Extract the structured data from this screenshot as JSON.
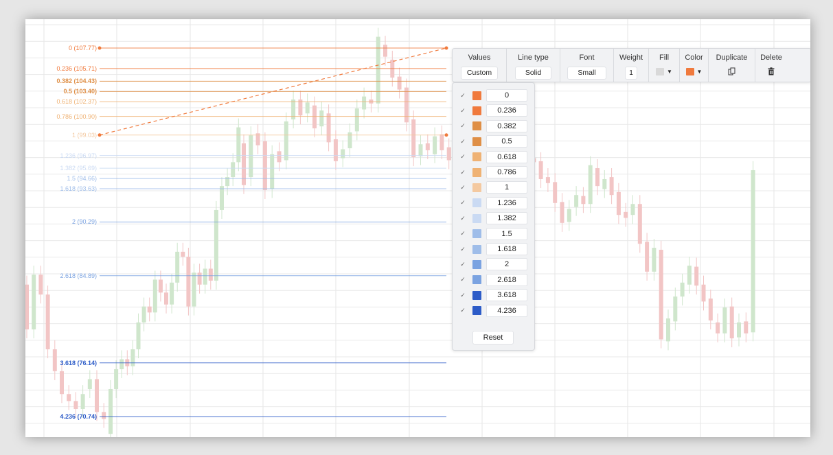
{
  "fib_levels": [
    {
      "ratio": "0",
      "label": "0 (107.77)",
      "price": 107.77,
      "color": "#f07a3d"
    },
    {
      "ratio": "0.236",
      "label": "0.236 (105.71)",
      "price": 105.71,
      "color": "#f07a3d"
    },
    {
      "ratio": "0.382",
      "label": "0.382 (104.43)",
      "price": 104.43,
      "color": "#df8f46"
    },
    {
      "ratio": "0.5",
      "label": "0.5 (103.40)",
      "price": 103.4,
      "color": "#df8f46"
    },
    {
      "ratio": "0.618",
      "label": "0.618 (102.37)",
      "price": 102.37,
      "color": "#efb274"
    },
    {
      "ratio": "0.786",
      "label": "0.786 (100.90)",
      "price": 100.9,
      "color": "#efb274"
    },
    {
      "ratio": "1",
      "label": "1 (99.03)",
      "price": 99.03,
      "color": "#f4c9a0"
    },
    {
      "ratio": "1.236",
      "label": "1.236 (96.97)",
      "price": 96.97,
      "color": "#cadaf3"
    },
    {
      "ratio": "1.382",
      "label": "1.382 (95.69)",
      "price": 95.69,
      "color": "#cadaf3"
    },
    {
      "ratio": "1.5",
      "label": "1.5 (94.66)",
      "price": 94.66,
      "color": "#9fbde9"
    },
    {
      "ratio": "1.618",
      "label": "1.618 (93.63)",
      "price": 93.63,
      "color": "#9fbde9"
    },
    {
      "ratio": "2",
      "label": "2 (90.29)",
      "price": 90.29,
      "color": "#7ba3e1"
    },
    {
      "ratio": "2.618",
      "label": "2.618 (84.89)",
      "price": 84.89,
      "color": "#7ba3e1"
    },
    {
      "ratio": "3.618",
      "label": "3.618 (76.14)",
      "price": 76.14,
      "color": "#2d5cc8"
    },
    {
      "ratio": "4.236",
      "label": "4.236 (70.74)",
      "price": 70.74,
      "color": "#2d5cc8"
    }
  ],
  "price_axis": {
    "top_price": 107.77,
    "bottom_price": 70.74
  },
  "toolbar": {
    "values_title": "Values",
    "values_value": "Custom",
    "linetype_title": "Line type",
    "linetype_value": "Solid",
    "font_title": "Font",
    "font_value": "Small",
    "weight_title": "Weight",
    "weight_value": "1",
    "fill_title": "Fill",
    "fill_color": "#d9d9d9",
    "color_title": "Color",
    "color_value": "#f07a3d",
    "duplicate_title": "Duplicate",
    "delete_title": "Delete"
  },
  "panel": {
    "reset_label": "Reset"
  },
  "candles": [
    [
      98.2,
      94.0
    ],
    [
      94.8,
      99.0
    ],
    [
      99.2,
      98.0
    ],
    [
      98.4,
      93.5
    ],
    [
      93.6,
      97.1
    ],
    [
      97.4,
      96.3
    ],
    [
      96.5,
      100.4
    ],
    [
      100.6,
      102.6
    ],
    [
      102.6,
      101.0
    ],
    [
      101.2,
      102.3
    ],
    [
      102.0,
      99.7
    ],
    [
      99.9,
      101.5
    ],
    [
      101.2,
      98.3
    ],
    [
      98.6,
      96.4
    ],
    [
      96.7,
      97.6
    ],
    [
      97.7,
      99.3
    ],
    [
      99.4,
      101.7
    ],
    [
      101.6,
      102.9
    ],
    [
      102.6,
      102.2
    ],
    [
      102.2,
      108.9
    ],
    [
      108.1,
      106.9
    ],
    [
      106.6,
      104.8
    ],
    [
      104.9,
      103.6
    ],
    [
      103.8,
      100.3
    ],
    [
      100.6,
      96.8
    ],
    [
      96.9,
      98.1
    ],
    [
      98.2,
      97.5
    ],
    [
      97.1,
      98.9
    ],
    [
      99.1,
      97.5
    ],
    [
      97.8,
      96.5
    ],
    [
      96.5,
      94.4
    ],
    [
      94.6,
      98.3
    ],
    [
      98.2,
      99.3
    ],
    [
      99.4,
      98.5
    ],
    [
      98.8,
      97.8
    ],
    [
      98.0,
      100.3
    ],
    [
      100.1,
      98.3
    ],
    [
      98.2,
      96.9
    ],
    [
      96.6,
      95.3
    ],
    [
      95.4,
      97.7
    ],
    [
      97.7,
      96.8
    ],
    [
      96.7,
      96.3
    ],
    [
      96.4,
      94.6
    ],
    [
      94.8,
      94.2
    ],
    [
      94.3,
      92.2
    ],
    [
      92.3,
      90.2
    ],
    [
      90.3,
      91.6
    ],
    [
      91.8,
      93.0
    ],
    [
      92.9,
      92.1
    ],
    [
      92.1,
      96.0
    ],
    [
      95.7,
      93.9
    ],
    [
      93.6,
      94.6
    ],
    [
      94.8,
      93.0
    ],
    [
      93.3,
      91.0
    ],
    [
      91.3,
      90.7
    ],
    [
      91.0,
      92.1
    ],
    [
      92.1,
      88.1
    ],
    [
      88.3,
      85.3
    ],
    [
      85.3,
      87.7
    ],
    [
      87.5,
      78.5
    ],
    [
      78.3,
      80.6
    ],
    [
      80.3,
      82.8
    ],
    [
      82.8,
      84.2
    ],
    [
      84.0,
      85.9
    ],
    [
      85.8,
      83.9
    ],
    [
      84.0,
      82.3
    ],
    [
      82.6,
      80.4
    ],
    [
      80.2,
      79.1
    ],
    [
      79.1,
      81.7
    ],
    [
      81.8,
      78.6
    ],
    [
      78.7,
      80.2
    ],
    [
      80.3,
      79.1
    ],
    [
      79.2,
      95.5
    ]
  ],
  "left_candles": [
    [
      84.0,
      79.5
    ],
    [
      79.5,
      85.0
    ],
    [
      85.0,
      83.0
    ],
    [
      83.0,
      77.5
    ],
    [
      77.5,
      75.3
    ],
    [
      75.3,
      73.0
    ],
    [
      73.0,
      72.3
    ],
    [
      72.3,
      71.5
    ],
    [
      71.5,
      73.0
    ],
    [
      73.5,
      74.5
    ],
    [
      74.5,
      71.2
    ],
    [
      71.2,
      70.5
    ]
  ],
  "rising_candles": [
    [
      69.0,
      73.5
    ],
    [
      73.5,
      75.5
    ],
    [
      75.5,
      76.5
    ],
    [
      76.5,
      75.8
    ],
    [
      75.8,
      77.5
    ],
    [
      77.5,
      80.2
    ],
    [
      80.2,
      81.8
    ],
    [
      81.8,
      81.2
    ],
    [
      81.2,
      84.5
    ],
    [
      84.5,
      83.2
    ],
    [
      83.2,
      82.0
    ],
    [
      82.0,
      84.2
    ],
    [
      84.2,
      87.3
    ],
    [
      87.3,
      86.8
    ],
    [
      86.8,
      81.8
    ],
    [
      81.8,
      85.2
    ],
    [
      85.2,
      84.0
    ],
    [
      84.0,
      85.6
    ],
    [
      85.6,
      84.4
    ],
    [
      84.4,
      91.5
    ],
    [
      91.5,
      93.9
    ],
    [
      93.9,
      94.8
    ],
    [
      94.8,
      96.3
    ],
    [
      96.3,
      99.8
    ]
  ]
}
